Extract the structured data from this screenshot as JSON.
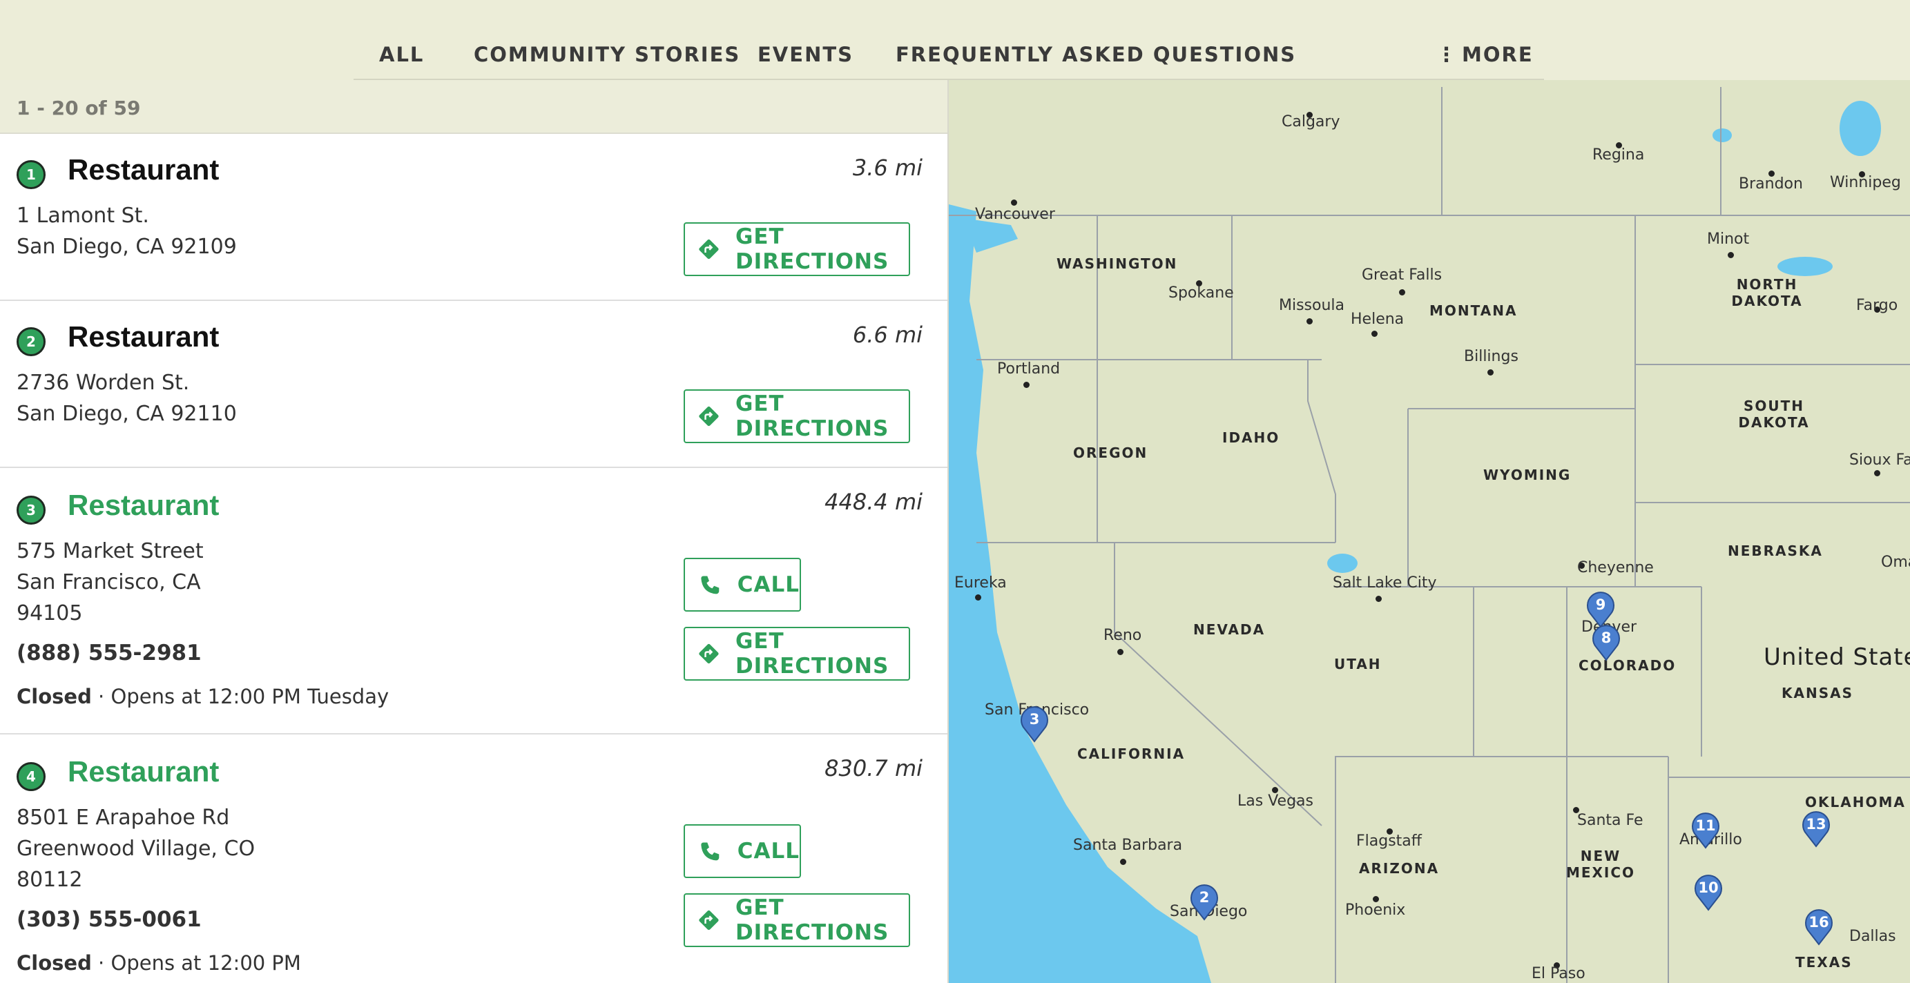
{
  "nav": {
    "items": [
      "ALL",
      "COMMUNITY STORIES",
      "EVENTS",
      "FREQUENTLY ASKED QUESTIONS"
    ],
    "more_label": "MORE"
  },
  "results": {
    "count_label": "1 - 20 of 59"
  },
  "locations": [
    {
      "number": "1",
      "name": "Restaurant",
      "distance": "3.6 mi",
      "address_lines": [
        "1 Lamont St.",
        "San Diego, CA 92109"
      ],
      "directions_label": "GET DIRECTIONS"
    },
    {
      "number": "2",
      "name": "Restaurant",
      "distance": "6.6 mi",
      "address_lines": [
        "2736 Worden St.",
        "San Diego, CA 92110"
      ],
      "directions_label": "GET DIRECTIONS"
    },
    {
      "number": "3",
      "name": "Restaurant",
      "distance": "448.4 mi",
      "address_lines": [
        "575 Market Street",
        "San Francisco, CA",
        "94105"
      ],
      "phone": "(888) 555-2981",
      "status": "Closed",
      "hours_text": " · Opens at 12:00 PM Tuesday",
      "call_label": "CALL",
      "directions_label": "GET DIRECTIONS"
    },
    {
      "number": "4",
      "name": "Restaurant",
      "distance": "830.7 mi",
      "address_lines": [
        "8501 E Arapahoe Rd",
        "Greenwood Village, CO",
        "80112"
      ],
      "phone": "(303) 555-0061",
      "status": "Closed",
      "hours_text": " · Opens at 12:00 PM",
      "call_label": "CALL",
      "directions_label": "GET DIRECTIONS"
    }
  ],
  "map": {
    "cities": [
      "Calgary",
      "Regina",
      "Brandon",
      "Winnipeg",
      "Vancouver",
      "Spokane",
      "Great Falls",
      "Missoula",
      "Helena",
      "Billings",
      "Minot",
      "Fargo",
      "Portland",
      "Sioux Falls",
      "Cheyenne",
      "Oma",
      "Eureka",
      "Salt Lake City",
      "Reno",
      "Denver",
      "San Francisco",
      "Las Vegas",
      "Santa Fe",
      "Amarillo",
      "Flagstaff",
      "Santa Barbara",
      "San Diego",
      "Phoenix",
      "Dallas",
      "El Paso"
    ],
    "states": [
      "WASHINGTON",
      "MONTANA",
      "NORTH DAKOTA",
      "SOUTH DAKOTA",
      "OREGON",
      "IDAHO",
      "WYOMING",
      "NEBRASKA",
      "NEVADA",
      "UTAH",
      "COLORADO",
      "KANSAS",
      "CALIFORNIA",
      "OKLAHOMA",
      "NEW MEXICO",
      "ARIZONA",
      "TEXAS"
    ],
    "country": "United States",
    "pins": [
      "9",
      "8",
      "3",
      "11",
      "13",
      "10",
      "2",
      "16"
    ]
  },
  "colors": {
    "accent": "#2fa05a",
    "pin": "#4a7fcf",
    "water": "#6cc8ee",
    "land": "#dfe4c7",
    "background": "#ecedda"
  },
  "icons": {
    "directions": "directions-icon",
    "call": "phone-icon",
    "more": "vertical-dots-icon"
  }
}
